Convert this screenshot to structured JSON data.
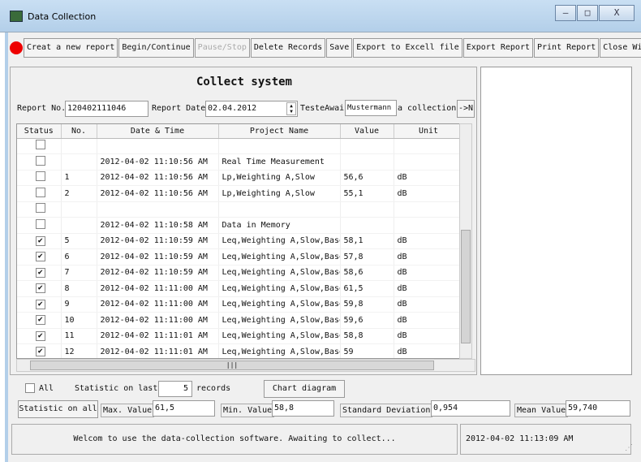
{
  "window": {
    "title": "Data Collection",
    "min": "–",
    "max": "□",
    "close": "X"
  },
  "toolbar": [
    "Creat a new report",
    "Begin/Continue",
    "Pause/Stop",
    "Delete Records",
    "Save",
    "Export to Excell file",
    "Export Report",
    "Print Report",
    "Close Window"
  ],
  "form": {
    "heading": "Collect system",
    "report_no_label": "Report No.",
    "report_no": "120402111046",
    "report_date_label": "Report Date",
    "report_date": "02.04.2012",
    "tester_label": "TesteAwai",
    "tester": "Mustermann",
    "collection_label": "a collection",
    "arrow_button": "->N"
  },
  "table": {
    "headers": [
      "Status",
      "No.",
      "Date & Time",
      "Project Name",
      "Value",
      "Unit"
    ],
    "rows": [
      {
        "checked": false,
        "no": "",
        "dt": "",
        "project": "",
        "value": "",
        "unit": ""
      },
      {
        "checked": false,
        "no": "",
        "dt": "2012-04-02 11:10:56 AM",
        "project": "Real Time Measurement",
        "value": "",
        "unit": ""
      },
      {
        "checked": false,
        "no": "1",
        "dt": "2012-04-02 11:10:56 AM",
        "project": "Lp,Weighting A,Slow",
        "value": "56,6",
        "unit": "dB"
      },
      {
        "checked": false,
        "no": "2",
        "dt": "2012-04-02 11:10:56 AM",
        "project": "Lp,Weighting A,Slow",
        "value": "55,1",
        "unit": "dB"
      },
      {
        "checked": false,
        "no": "",
        "dt": "",
        "project": "",
        "value": "",
        "unit": ""
      },
      {
        "checked": false,
        "no": "",
        "dt": "2012-04-02 11:10:58 AM",
        "project": "Data in Memory",
        "value": "",
        "unit": ""
      },
      {
        "checked": true,
        "no": "5",
        "dt": "2012-04-02 11:10:59 AM",
        "project": "Leq,Weighting A,Slow,Base",
        "value": "58,1",
        "unit": "dB"
      },
      {
        "checked": true,
        "no": "6",
        "dt": "2012-04-02 11:10:59 AM",
        "project": "Leq,Weighting A,Slow,Base",
        "value": "57,8",
        "unit": "dB"
      },
      {
        "checked": true,
        "no": "7",
        "dt": "2012-04-02 11:10:59 AM",
        "project": "Leq,Weighting A,Slow,Base",
        "value": "58,6",
        "unit": "dB"
      },
      {
        "checked": true,
        "no": "8",
        "dt": "2012-04-02 11:11:00 AM",
        "project": "Leq,Weighting A,Slow,Base",
        "value": "61,5",
        "unit": "dB"
      },
      {
        "checked": true,
        "no": "9",
        "dt": "2012-04-02 11:11:00 AM",
        "project": "Leq,Weighting A,Slow,Base",
        "value": "59,8",
        "unit": "dB"
      },
      {
        "checked": true,
        "no": "10",
        "dt": "2012-04-02 11:11:00 AM",
        "project": "Leq,Weighting A,Slow,Base",
        "value": "59,6",
        "unit": "dB"
      },
      {
        "checked": true,
        "no": "11",
        "dt": "2012-04-02 11:11:01 AM",
        "project": "Leq,Weighting A,Slow,Base",
        "value": "58,8",
        "unit": "dB"
      },
      {
        "checked": true,
        "no": "12",
        "dt": "2012-04-02 11:11:01 AM",
        "project": "Leq,Weighting A,Slow,Base",
        "value": "59",
        "unit": "dB"
      }
    ]
  },
  "stats": {
    "all_label": "All",
    "last_label": "Statistic on last",
    "last_count": "5",
    "records_label": "records",
    "chart_button": "Chart diagram",
    "on_all_label": "Statistic on all",
    "max_label": "Max. Value",
    "max": "61,5",
    "min_label": "Min. Value",
    "min": "58,8",
    "std_label": "Standard Deviation",
    "std": "0,954",
    "mean_label": "Mean Value",
    "mean": "59,740"
  },
  "status": {
    "message": "Welcom to use the data-collection software. Awaiting to collect...",
    "time": "2012-04-02 11:13:09 AM"
  }
}
